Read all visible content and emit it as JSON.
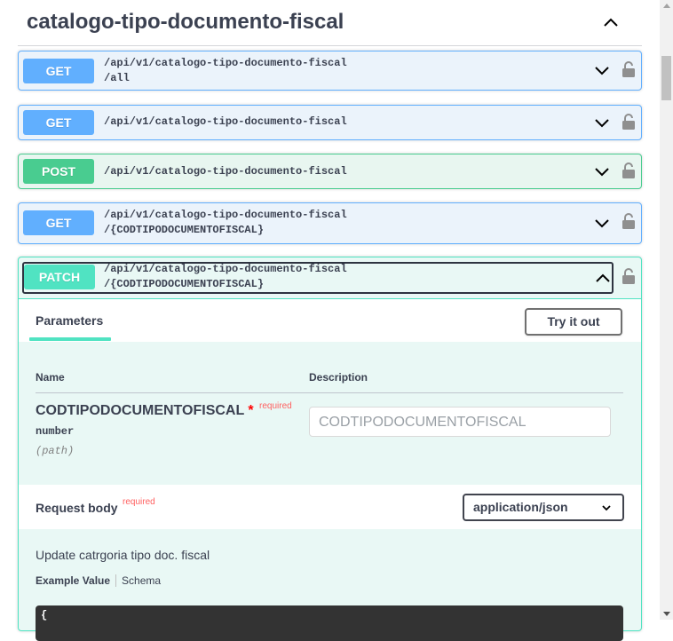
{
  "section": {
    "title": "catalogo-tipo-documento-fiscal"
  },
  "operations": [
    {
      "method": "GET",
      "path_line1": "/api/v1/catalogo-tipo-documento-fiscal",
      "path_line2": "/all"
    },
    {
      "method": "GET",
      "path_line1": "/api/v1/catalogo-tipo-documento-fiscal",
      "path_line2": ""
    },
    {
      "method": "POST",
      "path_line1": "/api/v1/catalogo-tipo-documento-fiscal",
      "path_line2": ""
    },
    {
      "method": "GET",
      "path_line1": "/api/v1/catalogo-tipo-documento-fiscal",
      "path_line2": "/{CODTIPODOCUMENTOFISCAL}"
    },
    {
      "method": "PATCH",
      "path_line1": "/api/v1/catalogo-tipo-documento-fiscal",
      "path_line2": "/{CODTIPODOCUMENTOFISCAL}"
    }
  ],
  "expanded": {
    "tab_parameters": "Parameters",
    "try_button": "Try it out",
    "col_name": "Name",
    "col_description": "Description",
    "param": {
      "name": "CODTIPODOCUMENTOFISCAL",
      "star": "*",
      "required": "required",
      "type": "number",
      "in": "(path)",
      "placeholder": "CODTIPODOCUMENTOFISCAL"
    },
    "request_body": {
      "label": "Request body",
      "required": "required",
      "content_type": "application/json",
      "description": "Update catrgoria tipo doc. fiscal",
      "example_value_tab": "Example Value",
      "schema_tab": "Schema",
      "code_start": "{"
    }
  },
  "colors": {
    "get": "#61affe",
    "post": "#49cc90",
    "patch": "#50e3c2"
  }
}
